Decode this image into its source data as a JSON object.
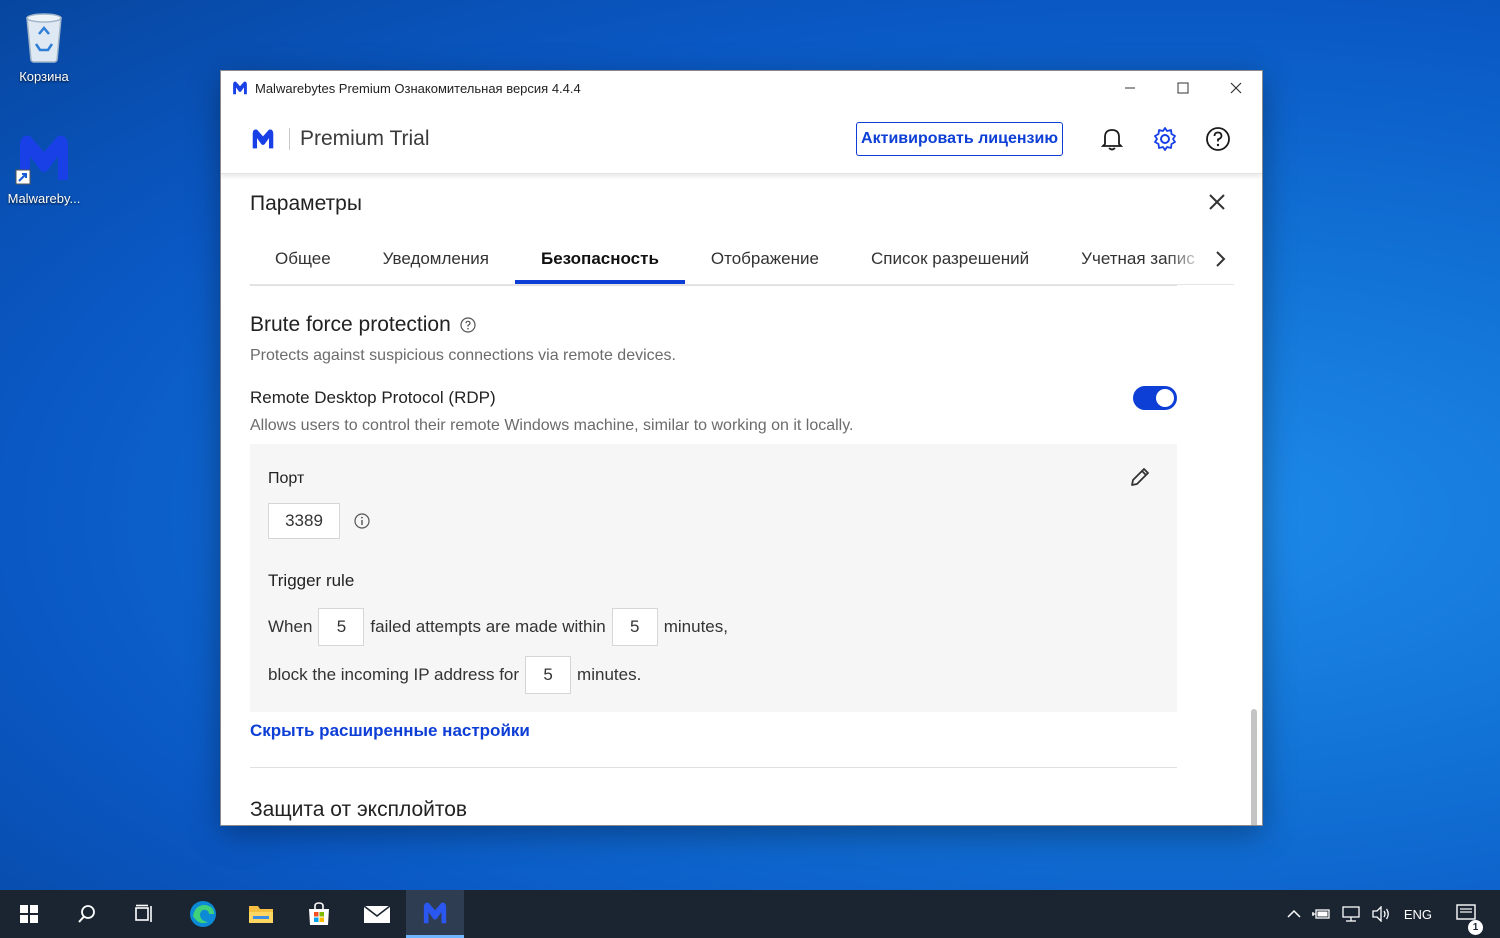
{
  "desktop": {
    "icons": [
      {
        "label": "Корзина"
      },
      {
        "label": "Malwareby..."
      }
    ]
  },
  "window": {
    "title": "Malwarebytes Premium Ознакомительная версия  4.4.4",
    "brand": "Premium Trial",
    "activate_label": "Активировать лицензию",
    "accent": "#0d3ed6"
  },
  "settings": {
    "title": "Параметры",
    "tabs": [
      {
        "label": "Общее"
      },
      {
        "label": "Уведомления"
      },
      {
        "label": "Безопасность"
      },
      {
        "label": "Отображение"
      },
      {
        "label": "Список разрешений"
      },
      {
        "label": "Учетная запис"
      }
    ],
    "active_tab": "Безопасность"
  },
  "brute_force": {
    "title": "Brute force protection",
    "description": "Protects against suspicious connections via remote devices.",
    "rdp_label": "Remote Desktop Protocol (RDP)",
    "rdp_enabled": true,
    "rdp_description": "Allows users to control their remote Windows machine, similar to working on it locally.",
    "port_label": "Порт",
    "port_value": "3389",
    "trigger_label": "Trigger rule",
    "rule": {
      "when": "When",
      "attempts": "5",
      "failed_text": "failed attempts are made within",
      "within_minutes": "5",
      "minutes_comma": "minutes,",
      "block_text": "block the incoming IP address for",
      "block_minutes": "5",
      "minutes_period": "minutes."
    },
    "hide_advanced": "Скрыть расширенные настройки"
  },
  "next_section": {
    "title": "Защита от эксплойтов"
  },
  "taskbar": {
    "language": "ENG",
    "notification_count": "1",
    "apps": [
      "start-icon",
      "search-icon",
      "task-view-icon",
      "edge-icon",
      "file-explorer-icon",
      "store-icon",
      "mail-icon",
      "malwarebytes-icon"
    ]
  }
}
